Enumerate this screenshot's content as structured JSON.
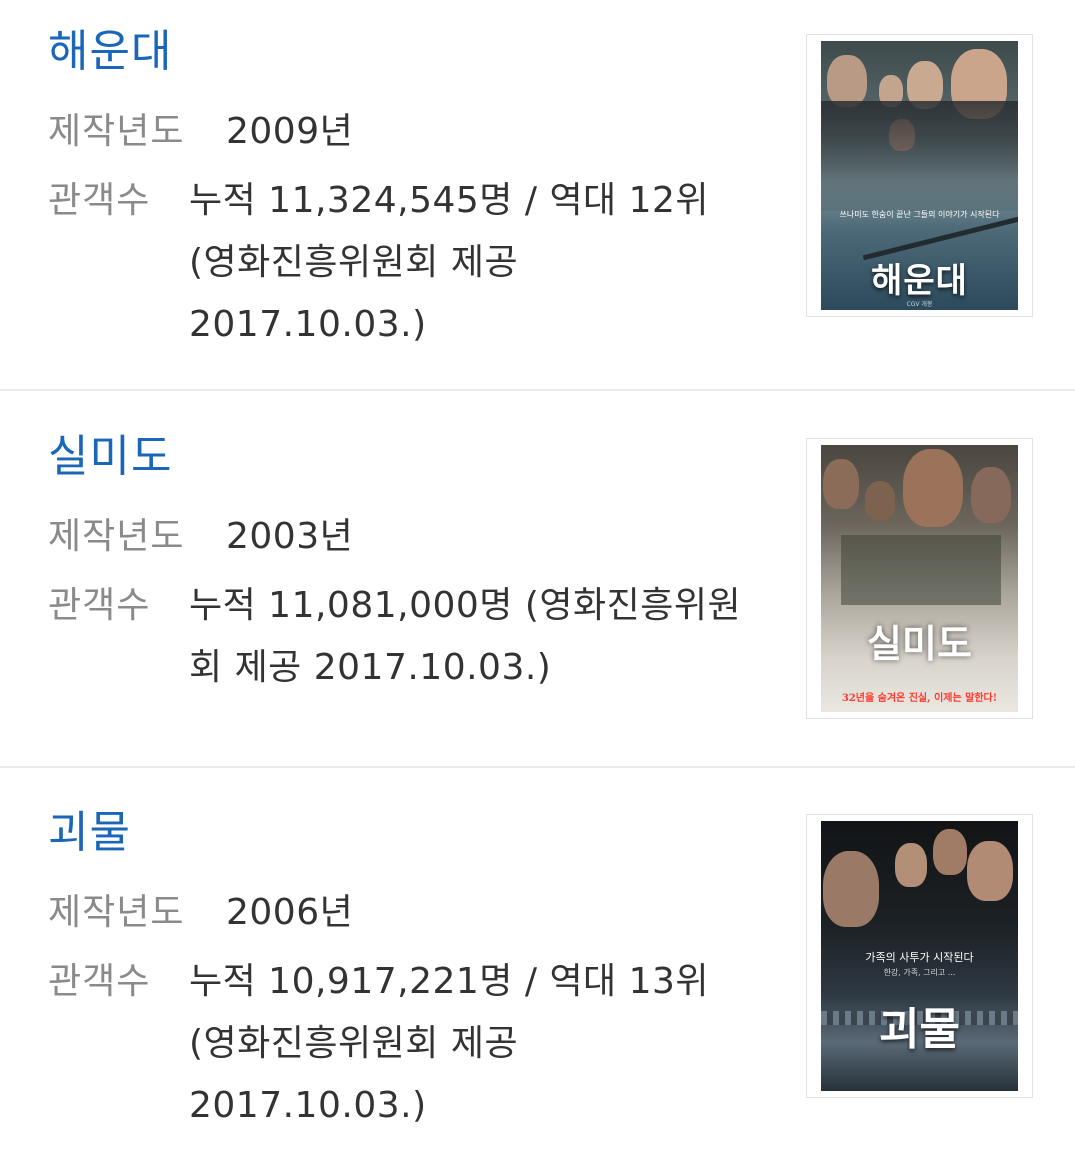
{
  "labels": {
    "year": "제작년도",
    "audience": "관객수"
  },
  "movies": [
    {
      "title": "해운대",
      "year": "2009년",
      "audience_lines": [
        "누적 11,324,545명 / 역대 12위",
        "(영화진흥위원회 제공",
        "2017.10.03.)"
      ],
      "poster": {
        "title_text": "해운대",
        "tagline": "쓰나미도 한숨이 끝난 그들의 이야기가 시작된다",
        "credit": "CGV 개봉"
      }
    },
    {
      "title": "실미도",
      "year": "2003년",
      "audience_lines": [
        "누적 11,081,000명 (영화진흥위원",
        "회 제공 2017.10.03.)"
      ],
      "poster": {
        "title_text": "실미도",
        "tagline": "32년을 숨겨온 진실, 이제는 말한다!"
      }
    },
    {
      "title": "괴물",
      "year": "2006년",
      "audience_lines": [
        "누적 10,917,221명 / 역대 13위",
        "(영화진흥위원회 제공",
        "2017.10.03.)"
      ],
      "poster": {
        "title_text": "괴물",
        "tagline": "가족의 사투가 시작된다",
        "subtagline": "한강, 가족, 그리고 ..."
      }
    }
  ]
}
